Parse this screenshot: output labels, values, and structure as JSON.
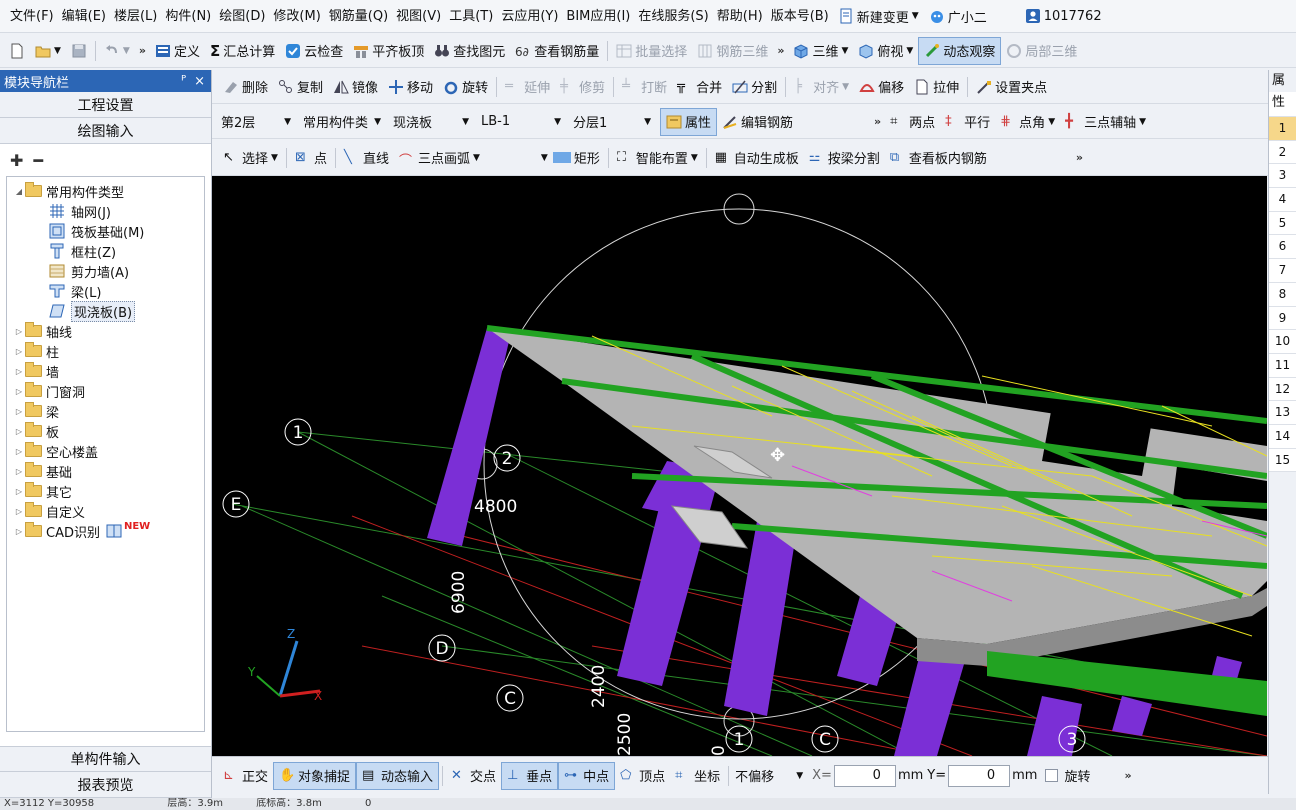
{
  "menu": [
    "文件(F)",
    "编辑(E)",
    "楼层(L)",
    "构件(N)",
    "绘图(D)",
    "修改(M)",
    "钢筋量(Q)",
    "视图(V)",
    "工具(T)",
    "云应用(Y)",
    "BIM应用(I)",
    "在线服务(S)",
    "帮助(H)",
    "版本号(B)"
  ],
  "menu_extra": {
    "new_change": "新建变更",
    "assistant": "广小二",
    "user_id": "1017762"
  },
  "toolbar1": {
    "define": "定义",
    "sum_calc": "汇总计算",
    "cloud_check": "云检查",
    "align_top": "平齐板顶",
    "find_element": "查找图元",
    "view_rebar_qty": "查看钢筋量",
    "batch_select": "批量选择",
    "rebar_3d": "钢筋三维",
    "view_3d": "三维",
    "top_view": "俯视",
    "dynamic_observe": "动态观察",
    "local_3d": "局部三维"
  },
  "sidebar": {
    "title": "模块导航栏",
    "pin": "ᴾ",
    "close": "×",
    "project_settings": "工程设置",
    "drawing_input": "绘图输入",
    "tree": {
      "root": "常用构件类型",
      "children": [
        "轴网(J)",
        "筏板基础(M)",
        "框柱(Z)",
        "剪力墙(A)",
        "梁(L)",
        "现浇板(B)"
      ],
      "groups": [
        "轴线",
        "柱",
        "墙",
        "门窗洞",
        "梁",
        "板",
        "空心楼盖",
        "基础",
        "其它",
        "自定义",
        "CAD识别"
      ],
      "new_badge": "NEW"
    },
    "single_input": "单构件输入",
    "report_preview": "报表预览"
  },
  "row1": {
    "delete": "删除",
    "copy": "复制",
    "mirror": "镜像",
    "move": "移动",
    "rotate": "旋转",
    "extend": "延伸",
    "trim": "修剪",
    "break": "打断",
    "merge": "合并",
    "split": "分割",
    "align": "对齐",
    "offset": "偏移",
    "stretch": "拉伸",
    "set_grip": "设置夹点"
  },
  "row2": {
    "floor": "第2层",
    "component_type": "常用构件类",
    "component": "现浇板",
    "name": "LB-1",
    "layer": "分层1",
    "properties": "属性",
    "edit_rebar": "编辑钢筋",
    "two_points": "两点",
    "parallel": "平行",
    "point_angle": "点角",
    "three_point_axis": "三点辅轴"
  },
  "row3": {
    "select": "选择",
    "point": "点",
    "line": "直线",
    "three_point_arc": "三点画弧",
    "rectangle": "矩形",
    "smart_layout": "智能布置",
    "auto_gen_slab": "自动生成板",
    "split_by_beam": "按梁分割",
    "view_slab_rebar": "查看板内钢筋"
  },
  "viewport": {
    "axis_labels": [
      "1",
      "2",
      "E",
      "D",
      "C",
      "1",
      "C",
      "3"
    ],
    "dimensions": [
      "4800",
      "6900",
      "2400",
      "2500",
      "0"
    ],
    "axes": {
      "z": "Z",
      "y": "Y",
      "x": "X"
    }
  },
  "statusbar": {
    "ortho": "正交",
    "snap": "对象捕捉",
    "dynamic_input": "动态输入",
    "intersection": "交点",
    "perpendicular": "垂点",
    "midpoint": "中点",
    "vertex": "顶点",
    "coordinate": "坐标",
    "offset_mode": "不偏移",
    "x_label": "X=",
    "x_value": "0",
    "y_label": "Y=",
    "y_value": "0",
    "unit": "mm",
    "rotate": "旋转"
  },
  "rightpanel": {
    "title": "属性",
    "rows": [
      "1",
      "2",
      "3",
      "4",
      "5",
      "6",
      "7",
      "8",
      "9",
      "10",
      "11",
      "12",
      "13",
      "14",
      "15"
    ]
  },
  "bottom_status": {
    "coords": "X=3112 Y=30958",
    "floor_height": "层高：3.9m",
    "base_height": "底标高：3.8m",
    "value": "0"
  },
  "colors": {
    "slab": "#b4b4b4",
    "column": "#7b2fd6",
    "beam": "#22a322",
    "rebar": "#e8e020",
    "nav_title": "#2c66b5"
  }
}
